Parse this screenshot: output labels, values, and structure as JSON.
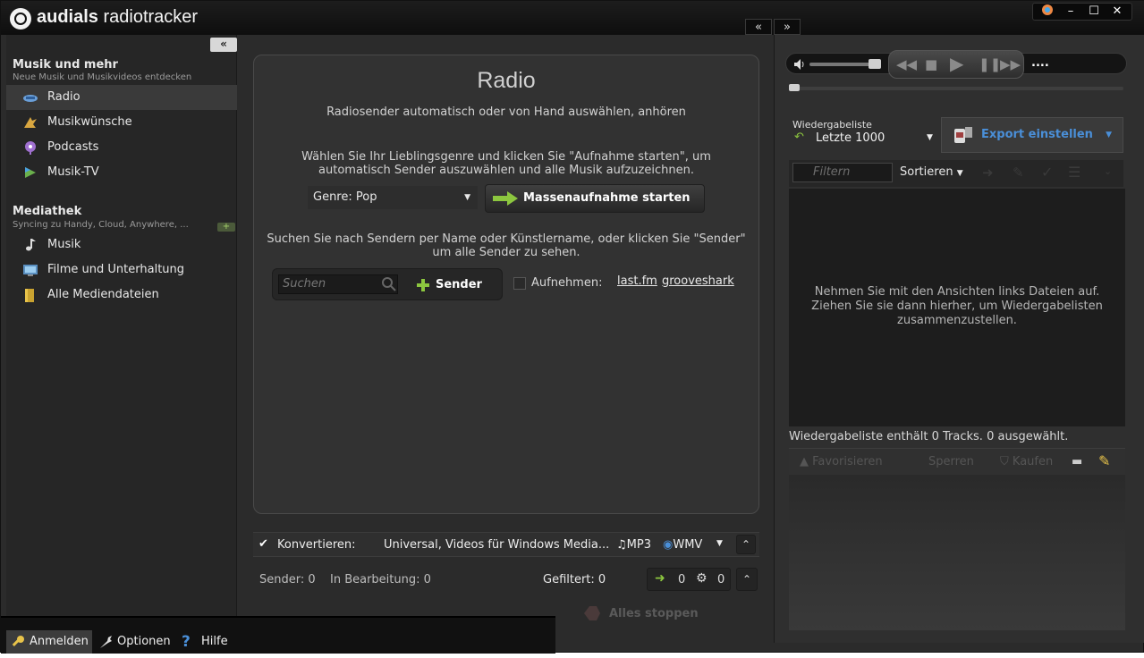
{
  "app": {
    "title_part1": "audials",
    "title_part2": "radiotracker",
    "collapse_left": "«",
    "collapse_right": "»",
    "win_controls": [
      "minimize-icon",
      "maximize-icon",
      "close-icon"
    ],
    "win_labels": [
      "–",
      "☐",
      "✕"
    ]
  },
  "sidebar": {
    "collapse": "«",
    "section1_title": "Musik und mehr",
    "section1_sub": "Neue Musik und Musikvideos entdecken",
    "items1": [
      {
        "label": "Radio",
        "icon": "radio-icon"
      },
      {
        "label": "Musikwünsche",
        "icon": "wishlist-icon"
      },
      {
        "label": "Podcasts",
        "icon": "podcast-icon"
      },
      {
        "label": "Musik-TV",
        "icon": "music-tv-icon"
      }
    ],
    "section2_title": "Mediathek",
    "section2_sub": "Syncing zu Handy, Cloud, Anywhere, ...",
    "add_label": "+",
    "items2": [
      {
        "label": "Musik",
        "icon": "music-note-icon"
      },
      {
        "label": "Filme und Unterhaltung",
        "icon": "film-icon"
      },
      {
        "label": "Alle Mediendateien",
        "icon": "folder-icon"
      }
    ]
  },
  "bottombar": {
    "login": "Anmelden",
    "options": "Optionen",
    "help": "Hilfe"
  },
  "center": {
    "title": "Radio",
    "subtitle": "Radiosender automatisch oder von Hand auswählen, anhören",
    "genre_text_line1": "Wählen Sie Ihr Lieblingsgenre und klicken Sie \"Aufnahme starten\", um",
    "genre_text_line2": "automatisch Sender auszuwählen und alle Musik aufzuzeichnen.",
    "genre_select": "Genre: Pop",
    "mass_record": "Massenaufnahme starten",
    "search_text_line1": "Suchen Sie nach Sendern per Name oder Künstlername, oder klicken Sie \"Sender\"",
    "search_text_line2": "um alle Sender zu sehen.",
    "search_placeholder": "Suchen",
    "sender_button": "Sender",
    "record_label": "Aufnehmen:",
    "link1": "last.fm",
    "link2": "grooveshark",
    "convert_label": "Konvertieren:",
    "convert_value": "Universal, Videos für Windows Media...",
    "format1": "MP3",
    "format2": "WMV",
    "status_sender": "Sender: 0",
    "status_processing": "In Bearbeitung: 0",
    "status_filtered": "Gefiltert: 0",
    "count_arrow": "0",
    "count_gear": "0",
    "stop_all": "Alles stoppen"
  },
  "right": {
    "playlist_label": "Wiedergabeliste",
    "playlist_value": "Letzte 1000",
    "export_label": "Export einstellen",
    "filter_placeholder": "Filtern",
    "sort_label": "Sortieren",
    "empty_line1": "Nehmen Sie mit den Ansichten links Dateien auf.",
    "empty_line2": "Ziehen Sie sie dann hierher, um Wiedergabelisten",
    "empty_line3": "zusammenzustellen.",
    "status": "Wiedergabeliste enthält 0 Tracks. 0 ausgewählt.",
    "act_fav": "Favorisieren",
    "act_block": "Sperren",
    "act_buy": "Kaufen",
    "player_more": "...."
  },
  "colors": {
    "accent_green": "#8cc63f",
    "link_blue": "#4a8fd8",
    "panel_dark": "#2b2b2b"
  }
}
